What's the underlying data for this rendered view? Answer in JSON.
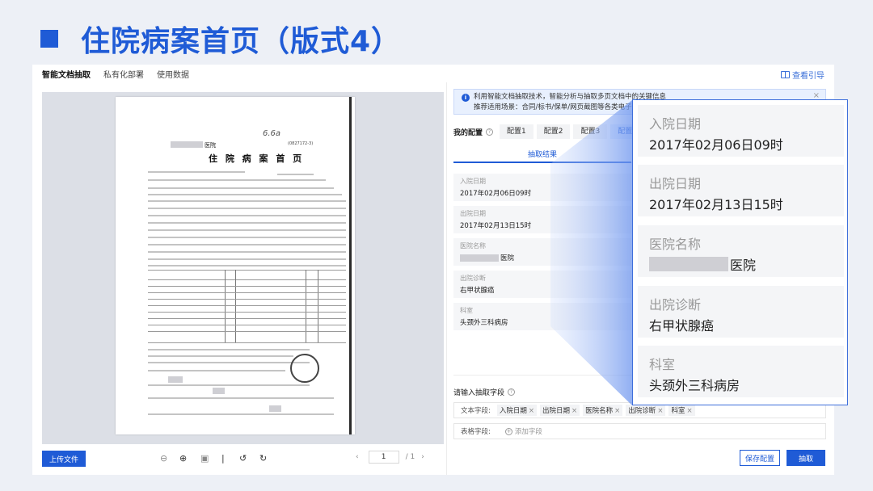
{
  "slide": {
    "title": "住院病案首页（版式4）"
  },
  "nav": {
    "items": [
      "智能文档抽取",
      "私有化部署",
      "使用数据"
    ],
    "guide": "查看引导"
  },
  "document": {
    "hospital_suffix": "医院",
    "title": "住 院 病 案 首 页",
    "doc_id": "(0827172-3)",
    "scribble": "6.6a"
  },
  "toolbar": {
    "upload": "上传文件",
    "page_current": "1",
    "page_total": "/ 1"
  },
  "banner": {
    "line1": "利用智能文档抽取技术，智能分析与抽取多页文档中的关键信息",
    "line2": "推荐适用场景：合同/标书/保单/网页截图等各类电子",
    "close": "×"
  },
  "config": {
    "label": "我的配置",
    "tabs": [
      "配置1",
      "配置2",
      "配置3",
      "配置4"
    ]
  },
  "result_tab": "抽取结果",
  "fields": [
    {
      "label": "入院日期",
      "value": "2017年02月06日09时"
    },
    {
      "label": "出院日期",
      "value": "2017年02月13日15时"
    },
    {
      "label": "医院名称",
      "value": "医院"
    },
    {
      "label": "出院诊断",
      "value": "右甲状腺癌"
    },
    {
      "label": "科室",
      "value": "头颈外三科病房"
    }
  ],
  "input": {
    "title": "请输入抽取字段",
    "text_label": "文本字段:",
    "tags": [
      "入院日期",
      "出院日期",
      "医院名称",
      "出院诊断",
      "科室"
    ],
    "table_label": "表格字段:",
    "add_label": "添加字段"
  },
  "buttons": {
    "save": "保存配置",
    "extract": "抽取"
  },
  "colors": {
    "brand": "#1f5bd6",
    "card_bg": "#f5f6f8",
    "banner_bg": "#e8f0fe"
  }
}
